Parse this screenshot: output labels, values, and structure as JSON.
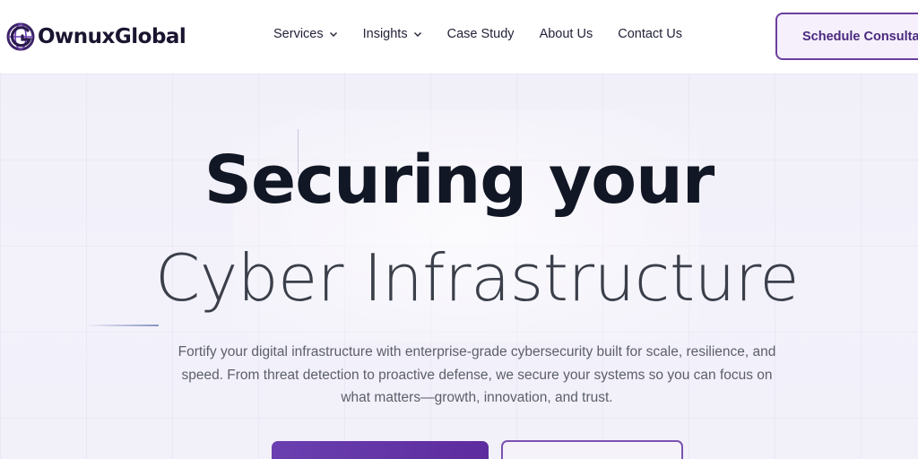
{
  "brand": {
    "name": "OwnuxGlobal",
    "logo_icon": "globe-g-logo",
    "accent": "#5d2c9e"
  },
  "nav": {
    "items": [
      {
        "label": "Services",
        "has_dropdown": true
      },
      {
        "label": "Insights",
        "has_dropdown": true
      },
      {
        "label": "Case Study",
        "has_dropdown": false
      },
      {
        "label": "About Us",
        "has_dropdown": false
      },
      {
        "label": "Contact Us",
        "has_dropdown": false
      }
    ],
    "cta_label": "Schedule Consultation"
  },
  "hero": {
    "title_line1": "Securing your",
    "title_line2": "Cyber Infrastructure",
    "description": "Fortify your digital infrastructure with enterprise-grade cybersecurity built for scale, resilience, and speed. From threat detection to proactive defense, we secure your systems so you can focus on what matters—growth, innovation, and trust."
  }
}
